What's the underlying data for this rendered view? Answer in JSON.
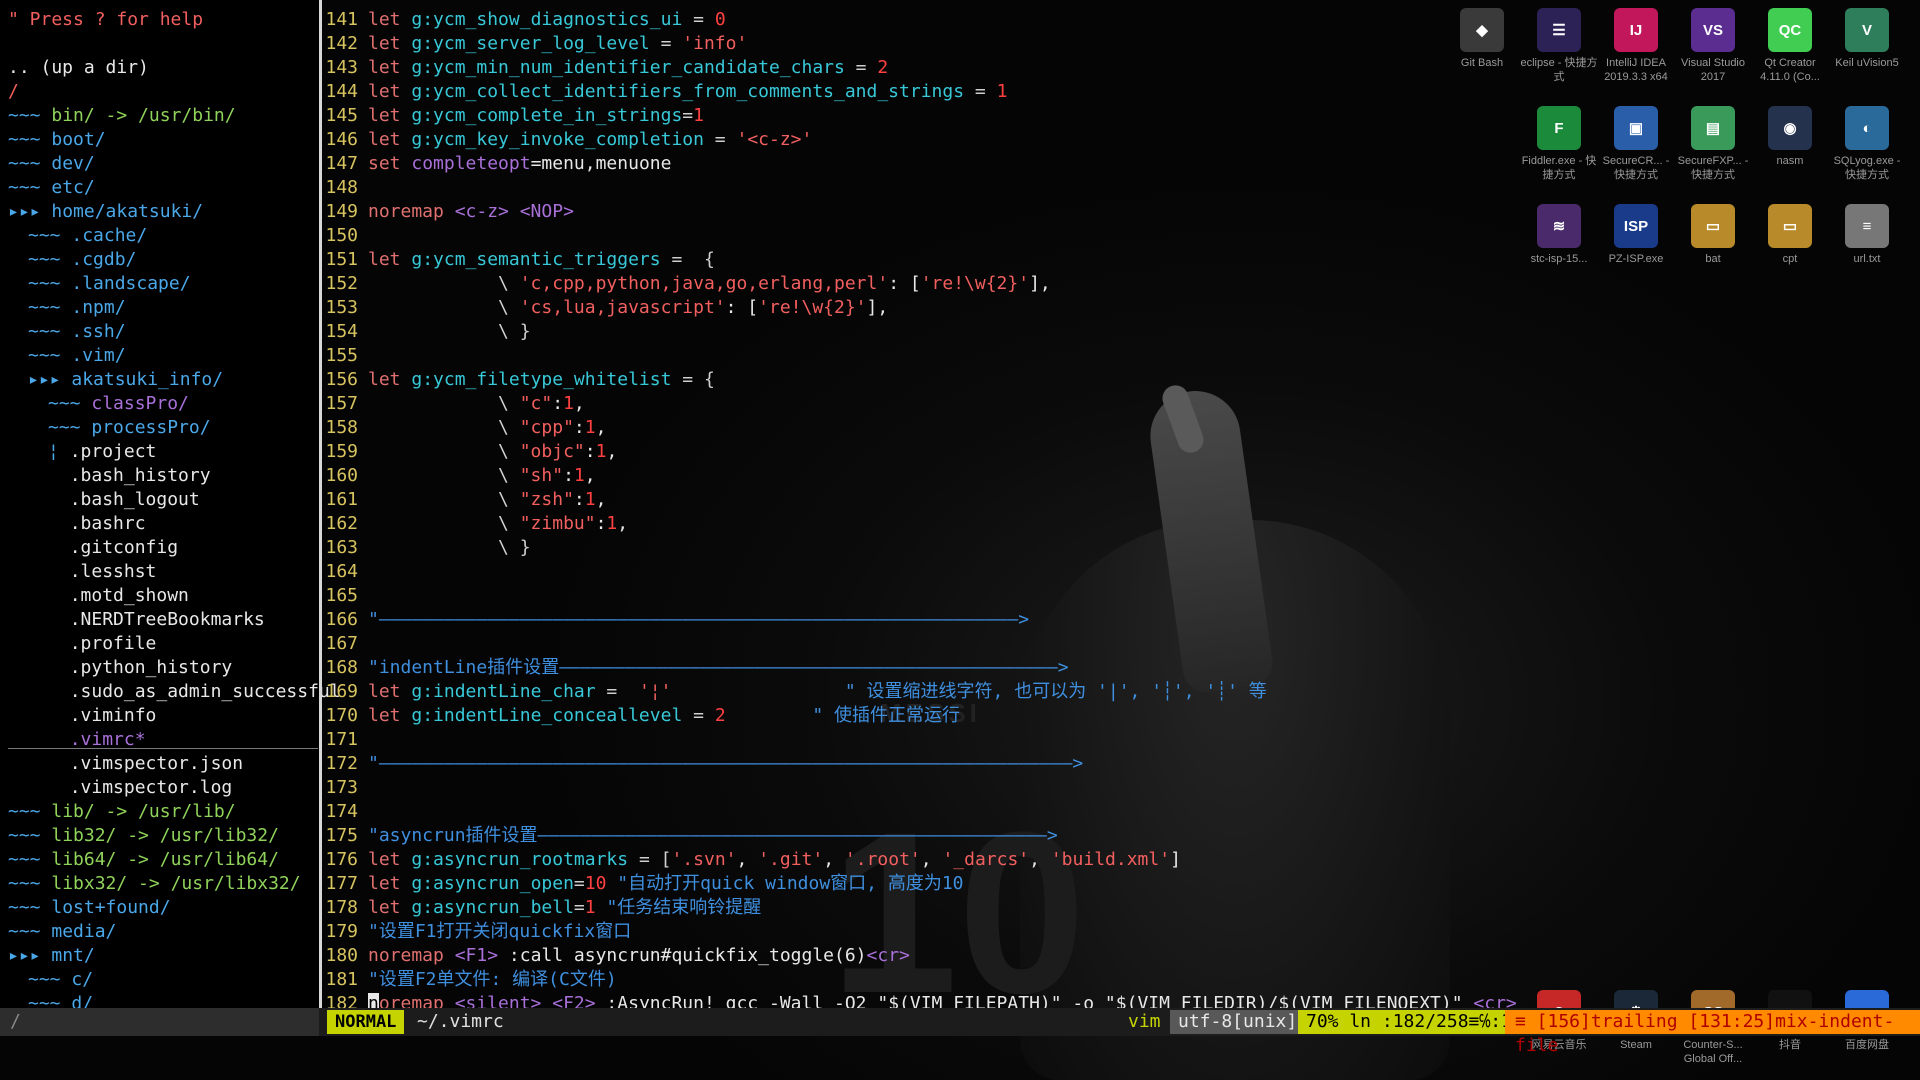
{
  "tree": {
    "help": "\" Press ? for help",
    "updir": ".. (up a dir)",
    "root": "/",
    "rows": [
      {
        "indent": 0,
        "marker": "~~~",
        "text": "bin/ -> /usr/bin/",
        "kind": "link"
      },
      {
        "indent": 0,
        "marker": "~~~",
        "text": "boot/",
        "kind": "dir"
      },
      {
        "indent": 0,
        "marker": "~~~",
        "text": "dev/",
        "kind": "dir"
      },
      {
        "indent": 0,
        "marker": "~~~",
        "text": "etc/",
        "kind": "dir"
      },
      {
        "indent": 0,
        "marker": "▸▸▸",
        "text": "home/akatsuki/",
        "kind": "dir"
      },
      {
        "indent": 1,
        "marker": "~~~",
        "text": ".cache/",
        "kind": "dir"
      },
      {
        "indent": 1,
        "marker": "~~~",
        "text": ".cgdb/",
        "kind": "dir"
      },
      {
        "indent": 1,
        "marker": "~~~",
        "text": ".landscape/",
        "kind": "dir"
      },
      {
        "indent": 1,
        "marker": "~~~",
        "text": ".npm/",
        "kind": "dir"
      },
      {
        "indent": 1,
        "marker": "~~~",
        "text": ".ssh/",
        "kind": "dir"
      },
      {
        "indent": 1,
        "marker": "~~~",
        "text": ".vim/",
        "kind": "dir"
      },
      {
        "indent": 1,
        "marker": "▸▸▸",
        "text": "akatsuki_info/",
        "kind": "dir"
      },
      {
        "indent": 2,
        "marker": "~~~",
        "text": "classPro/",
        "kind": "sp"
      },
      {
        "indent": 2,
        "marker": "~~~",
        "text": "processPro/",
        "kind": "dir"
      },
      {
        "indent": 2,
        "marker": "¦",
        "text": ".project",
        "kind": "file"
      },
      {
        "indent": 2,
        "marker": "",
        "text": ".bash_history",
        "kind": "file"
      },
      {
        "indent": 2,
        "marker": "",
        "text": ".bash_logout",
        "kind": "file"
      },
      {
        "indent": 2,
        "marker": "",
        "text": ".bashrc",
        "kind": "file"
      },
      {
        "indent": 2,
        "marker": "",
        "text": ".gitconfig",
        "kind": "file"
      },
      {
        "indent": 2,
        "marker": "",
        "text": ".lesshst",
        "kind": "file"
      },
      {
        "indent": 2,
        "marker": "",
        "text": ".motd_shown",
        "kind": "file"
      },
      {
        "indent": 2,
        "marker": "",
        "text": ".NERDTreeBookmarks",
        "kind": "file"
      },
      {
        "indent": 2,
        "marker": "",
        "text": ".profile",
        "kind": "file"
      },
      {
        "indent": 2,
        "marker": "",
        "text": ".python_history",
        "kind": "file"
      },
      {
        "indent": 2,
        "marker": "",
        "text": ".sudo_as_admin_successful",
        "kind": "file"
      },
      {
        "indent": 2,
        "marker": "",
        "text": ".viminfo",
        "kind": "file"
      },
      {
        "indent": 2,
        "marker": "",
        "text": ".vimrc*",
        "kind": "sp"
      },
      {
        "indent": 2,
        "marker": "",
        "text": ".vimspector.json",
        "kind": "file"
      },
      {
        "indent": 2,
        "marker": "",
        "text": ".vimspector.log",
        "kind": "file"
      },
      {
        "indent": 0,
        "marker": "~~~",
        "text": "lib/ -> /usr/lib/",
        "kind": "link"
      },
      {
        "indent": 0,
        "marker": "~~~",
        "text": "lib32/ -> /usr/lib32/",
        "kind": "link"
      },
      {
        "indent": 0,
        "marker": "~~~",
        "text": "lib64/ -> /usr/lib64/",
        "kind": "link"
      },
      {
        "indent": 0,
        "marker": "~~~",
        "text": "libx32/ -> /usr/libx32/",
        "kind": "link"
      },
      {
        "indent": 0,
        "marker": "~~~",
        "text": "lost+found/",
        "kind": "dir"
      },
      {
        "indent": 0,
        "marker": "~~~",
        "text": "media/",
        "kind": "dir"
      },
      {
        "indent": 0,
        "marker": "▸▸▸",
        "text": "mnt/",
        "kind": "dir"
      },
      {
        "indent": 1,
        "marker": "~~~",
        "text": "c/",
        "kind": "dir"
      },
      {
        "indent": 1,
        "marker": "~~~",
        "text": "d/",
        "kind": "dir"
      }
    ],
    "status": "/"
  },
  "editor": {
    "lines": [
      {
        "n": "141",
        "t": [
          [
            "kw",
            "let "
          ],
          [
            "var",
            "g:ycm_show_diagnostics_ui"
          ],
          [
            "op",
            " = "
          ],
          [
            "num",
            "0"
          ]
        ]
      },
      {
        "n": "142",
        "t": [
          [
            "kw",
            "let "
          ],
          [
            "var",
            "g:ycm_server_log_level"
          ],
          [
            "op",
            " = "
          ],
          [
            "str",
            "'info'"
          ]
        ]
      },
      {
        "n": "143",
        "t": [
          [
            "kw",
            "let "
          ],
          [
            "var",
            "g:ycm_min_num_identifier_candidate_chars"
          ],
          [
            "op",
            " = "
          ],
          [
            "num",
            "2"
          ]
        ]
      },
      {
        "n": "144",
        "t": [
          [
            "kw",
            "let "
          ],
          [
            "var",
            "g:ycm_collect_identifiers_from_comments_and_strings"
          ],
          [
            "op",
            " = "
          ],
          [
            "num",
            "1"
          ]
        ]
      },
      {
        "n": "145",
        "t": [
          [
            "kw",
            "let "
          ],
          [
            "var",
            "g:ycm_complete_in_strings"
          ],
          [
            "op",
            "="
          ],
          [
            "num",
            "1"
          ]
        ]
      },
      {
        "n": "146",
        "t": [
          [
            "kw",
            "let "
          ],
          [
            "var",
            "g:ycm_key_invoke_completion"
          ],
          [
            "op",
            " = "
          ],
          [
            "str",
            "'<c-z>'"
          ]
        ]
      },
      {
        "n": "147",
        "t": [
          [
            "kw",
            "set "
          ],
          [
            "sp",
            "completeopt"
          ],
          [
            "plain",
            "=menu,menuone"
          ]
        ]
      },
      {
        "n": "148",
        "t": []
      },
      {
        "n": "149",
        "t": [
          [
            "kw",
            "noremap "
          ],
          [
            "sp",
            "<c-z> <NOP>"
          ]
        ]
      },
      {
        "n": "150",
        "t": []
      },
      {
        "n": "151",
        "t": [
          [
            "kw",
            "let "
          ],
          [
            "var",
            "g:ycm_semantic_triggers"
          ],
          [
            "op",
            " =  {"
          ]
        ]
      },
      {
        "n": "152",
        "t": [
          [
            "op",
            "            \\ "
          ],
          [
            "str",
            "'c,cpp,python,java,go,erlang,perl'"
          ],
          [
            "plain",
            ": ["
          ],
          [
            "str",
            "'re!\\w{2}'"
          ],
          [
            "plain",
            "],"
          ]
        ]
      },
      {
        "n": "153",
        "t": [
          [
            "op",
            "            \\ "
          ],
          [
            "str",
            "'cs,lua,javascript'"
          ],
          [
            "plain",
            ": ["
          ],
          [
            "str",
            "'re!\\w{2}'"
          ],
          [
            "plain",
            "],"
          ]
        ]
      },
      {
        "n": "154",
        "t": [
          [
            "op",
            "            \\ }"
          ]
        ]
      },
      {
        "n": "155",
        "t": []
      },
      {
        "n": "156",
        "t": [
          [
            "kw",
            "let "
          ],
          [
            "var",
            "g:ycm_filetype_whitelist"
          ],
          [
            "op",
            " = {"
          ]
        ]
      },
      {
        "n": "157",
        "t": [
          [
            "op",
            "            \\ "
          ],
          [
            "str",
            "\"c\""
          ],
          [
            "plain",
            ":"
          ],
          [
            "num",
            "1"
          ],
          [
            "plain",
            ","
          ]
        ]
      },
      {
        "n": "158",
        "t": [
          [
            "op",
            "            \\ "
          ],
          [
            "str",
            "\"cpp\""
          ],
          [
            "plain",
            ":"
          ],
          [
            "num",
            "1"
          ],
          [
            "plain",
            ","
          ]
        ]
      },
      {
        "n": "159",
        "t": [
          [
            "op",
            "            \\ "
          ],
          [
            "str",
            "\"objc\""
          ],
          [
            "plain",
            ":"
          ],
          [
            "num",
            "1"
          ],
          [
            "plain",
            ","
          ]
        ]
      },
      {
        "n": "160",
        "t": [
          [
            "op",
            "            \\ "
          ],
          [
            "str",
            "\"sh\""
          ],
          [
            "plain",
            ":"
          ],
          [
            "num",
            "1"
          ],
          [
            "plain",
            ","
          ]
        ]
      },
      {
        "n": "161",
        "t": [
          [
            "op",
            "            \\ "
          ],
          [
            "str",
            "\"zsh\""
          ],
          [
            "plain",
            ":"
          ],
          [
            "num",
            "1"
          ],
          [
            "plain",
            ","
          ]
        ]
      },
      {
        "n": "162",
        "t": [
          [
            "op",
            "            \\ "
          ],
          [
            "str",
            "\"zimbu\""
          ],
          [
            "plain",
            ":"
          ],
          [
            "num",
            "1"
          ],
          [
            "plain",
            ","
          ]
        ]
      },
      {
        "n": "163",
        "t": [
          [
            "op",
            "            \\ }"
          ]
        ]
      },
      {
        "n": "164",
        "t": []
      },
      {
        "n": "165",
        "t": []
      },
      {
        "n": "166",
        "t": [
          [
            "cm",
            "\"———————————————————————————————————————————————————————————>"
          ]
        ]
      },
      {
        "n": "167",
        "t": []
      },
      {
        "n": "168",
        "t": [
          [
            "cm",
            "\"indentLine插件设置——————————————————————————————————————————————>"
          ]
        ]
      },
      {
        "n": "169",
        "t": [
          [
            "kw",
            "let "
          ],
          [
            "var",
            "g:indentLine_char"
          ],
          [
            "op",
            " =  "
          ],
          [
            "str",
            "'¦'"
          ],
          [
            "cm",
            "                \" 设置缩进线字符, 也可以为 '|', '┆', '┊' 等"
          ]
        ]
      },
      {
        "n": "170",
        "t": [
          [
            "kw",
            "let "
          ],
          [
            "var",
            "g:indentLine_conceallevel"
          ],
          [
            "op",
            " = "
          ],
          [
            "num",
            "2"
          ],
          [
            "cm",
            "        \" 使插件正常运行"
          ]
        ]
      },
      {
        "n": "171",
        "t": []
      },
      {
        "n": "172",
        "t": [
          [
            "cm",
            "\"————————————————————————————————————————————————————————————————>"
          ]
        ]
      },
      {
        "n": "173",
        "t": []
      },
      {
        "n": "174",
        "t": []
      },
      {
        "n": "175",
        "t": [
          [
            "cm",
            "\"asyncrun插件设置———————————————————————————————————————————————>"
          ]
        ]
      },
      {
        "n": "176",
        "t": [
          [
            "kw",
            "let "
          ],
          [
            "var",
            "g:asyncrun_rootmarks"
          ],
          [
            "op",
            " = ["
          ],
          [
            "str",
            "'.svn'"
          ],
          [
            "plain",
            ", "
          ],
          [
            "str",
            "'.git'"
          ],
          [
            "plain",
            ", "
          ],
          [
            "str",
            "'.root'"
          ],
          [
            "plain",
            ", "
          ],
          [
            "str",
            "'_darcs'"
          ],
          [
            "plain",
            ", "
          ],
          [
            "str",
            "'build.xml'"
          ],
          [
            "plain",
            "]"
          ]
        ]
      },
      {
        "n": "177",
        "t": [
          [
            "kw",
            "let "
          ],
          [
            "var",
            "g:asyncrun_open"
          ],
          [
            "op",
            "="
          ],
          [
            "num",
            "10"
          ],
          [
            "cm",
            " \"自动打开quick window窗口, 高度为10"
          ]
        ]
      },
      {
        "n": "178",
        "t": [
          [
            "kw",
            "let "
          ],
          [
            "var",
            "g:asyncrun_bell"
          ],
          [
            "op",
            "="
          ],
          [
            "num",
            "1"
          ],
          [
            "cm",
            " \"任务结束响铃提醒"
          ]
        ]
      },
      {
        "n": "179",
        "t": [
          [
            "cm",
            "\"设置F1打开关闭quickfix窗口"
          ]
        ]
      },
      {
        "n": "180",
        "t": [
          [
            "kw",
            "noremap "
          ],
          [
            "sp",
            "<F1>"
          ],
          [
            "plain",
            " :call asyncrun#quickfix_toggle(6)"
          ],
          [
            "sp",
            "<cr>"
          ]
        ]
      },
      {
        "n": "181",
        "t": [
          [
            "cm",
            "\"设置F2单文件: 编译(C文件)"
          ]
        ]
      },
      {
        "n": "182",
        "t": [
          [
            "cursor",
            "n"
          ],
          [
            "kw",
            "oremap "
          ],
          [
            "sp",
            "<silent> <F2>"
          ],
          [
            "plain",
            " :AsyncRun! gcc -Wall -O2 \"$(VIM_FILEPATH)\" -o \"$(VIM_FILEDIR)/$(VIM_FILENOEXT)\" "
          ],
          [
            "sp",
            "<cr>"
          ]
        ]
      }
    ]
  },
  "status": {
    "mode": "NORMAL",
    "file": "~/.vimrc",
    "filetype": "vim",
    "encoding": "utf-8[unix]",
    "position": "70%  ln :182/258≡℅:1",
    "warning": "≡ [156]trailing [131:25]mix-indent-file"
  },
  "desktop": {
    "icons": [
      {
        "name": "Git Bash",
        "color": "#3a3a3a",
        "glyph": "◆",
        "row": 0,
        "col": 0
      },
      {
        "name": "eclipse - 快捷方式",
        "color": "#2c2255",
        "glyph": "☰",
        "row": 0,
        "col": 1
      },
      {
        "name": "IntelliJ IDEA 2019.3.3 x64",
        "color": "#c2185b",
        "glyph": "IJ",
        "row": 0,
        "col": 2
      },
      {
        "name": "Visual Studio 2017",
        "color": "#5c2d91",
        "glyph": "VS",
        "row": 0,
        "col": 3
      },
      {
        "name": "Qt Creator 4.11.0 (Co...",
        "color": "#41cd52",
        "glyph": "QC",
        "row": 0,
        "col": 4
      },
      {
        "name": "Keil uVision5",
        "color": "#2e7d5b",
        "glyph": "V",
        "row": 0,
        "col": 5
      },
      {
        "name": "Fiddler.exe - 快捷方式",
        "color": "#1b8a3a",
        "glyph": "F",
        "row": 1,
        "col": 1
      },
      {
        "name": "SecureCR... - 快捷方式",
        "color": "#2a5ea8",
        "glyph": "▣",
        "row": 1,
        "col": 2
      },
      {
        "name": "SecureFXP... - 快捷方式",
        "color": "#3a9a5a",
        "glyph": "▤",
        "row": 1,
        "col": 3
      },
      {
        "name": "nasm",
        "color": "#24324e",
        "glyph": "◉",
        "row": 1,
        "col": 4
      },
      {
        "name": "SQLyog.exe - 快捷方式",
        "color": "#2a6a9a",
        "glyph": "◐",
        "row": 1,
        "col": 5
      },
      {
        "name": "stc-isp-15...",
        "color": "#4a2a6a",
        "glyph": "≋",
        "row": 2,
        "col": 1
      },
      {
        "name": "PZ-ISP.exe",
        "color": "#1a3a8a",
        "glyph": "ISP",
        "row": 2,
        "col": 2
      },
      {
        "name": "bat",
        "color": "#b88a2a",
        "glyph": "▭",
        "row": 2,
        "col": 3
      },
      {
        "name": "cpt",
        "color": "#b88a2a",
        "glyph": "▭",
        "row": 2,
        "col": 4
      },
      {
        "name": "url.txt",
        "color": "#777777",
        "glyph": "≡",
        "row": 2,
        "col": 5
      }
    ],
    "bottom_icons": [
      {
        "name": "网易云音乐",
        "color": "#c62828",
        "glyph": "◎"
      },
      {
        "name": "Steam",
        "color": "#1b2838",
        "glyph": "⚙"
      },
      {
        "name": "Counter-S... Global Off...",
        "color": "#a26a2a",
        "glyph": "CS"
      },
      {
        "name": "抖音",
        "color": "#111111",
        "glyph": "♪"
      },
      {
        "name": "百度网盘",
        "color": "#2a6ad8",
        "glyph": "☁"
      }
    ]
  },
  "wallpaper": {
    "name": "MESSI",
    "number": "10"
  }
}
